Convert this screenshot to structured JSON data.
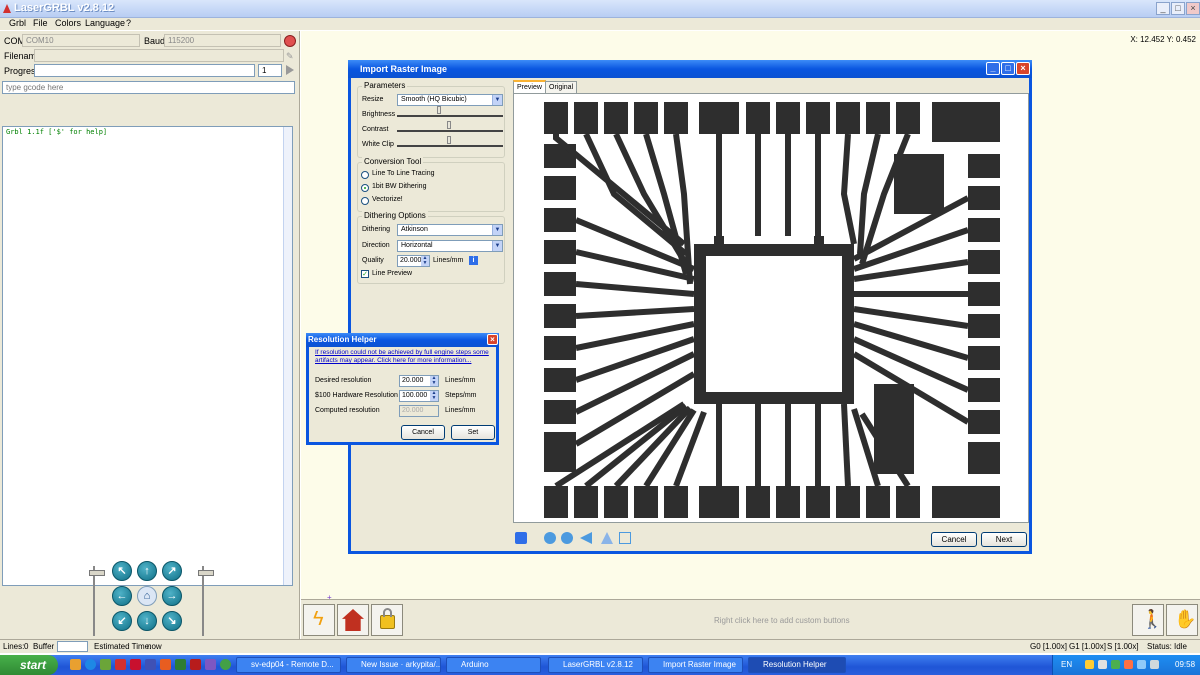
{
  "window": {
    "title": "LaserGRBL v2.8.12"
  },
  "menu": [
    "Grbl",
    "File",
    "Colors",
    "Language",
    "?"
  ],
  "connection": {
    "com_label": "COM",
    "com_value": "COM10",
    "baud_label": "Baud",
    "baud_value": "115200",
    "filename_label": "Filename",
    "filename_value": "",
    "progress_label": "Progress",
    "progress_count": "1",
    "gcode_placeholder": "type gcode here"
  },
  "console": {
    "line": "Grbl 1.1f ['$' for help]"
  },
  "jog_icons": [
    "arrow-up-left",
    "arrow-up",
    "arrow-up-right",
    "arrow-left",
    "home",
    "arrow-right",
    "arrow-down-left",
    "arrow-down",
    "arrow-down-right"
  ],
  "workspace": {
    "coords": "X: 12.452 Y: 0.452",
    "custom_hint": "Right click here to add custom buttons"
  },
  "status_bar": {
    "lines_label": "Lines:",
    "lines_value": "0",
    "buffer_label": "Buffer",
    "time_label": "Estimated Time:",
    "time_value": "now",
    "g0": "G0 [1.00x]",
    "g1": "G1 [1.00x]",
    "s": "S [1.00x]",
    "status_label": "Status:",
    "status_value": "Idle"
  },
  "taskbar": {
    "start": "start",
    "tasks": [
      "sv-edp04 - Remote D...",
      "New Issue · arkypita/...",
      "Arduino",
      "LaserGRBL v2.8.12",
      "Import Raster Image",
      "Resolution Helper"
    ],
    "lang": "EN",
    "clock": "09:58"
  },
  "import_dialog": {
    "title": "Import Raster Image",
    "parameters": "Parameters",
    "resize_label": "Resize",
    "resize_value": "Smooth (HQ Bicubic)",
    "brightness_label": "Brightness",
    "brightness_level": 0.4,
    "contrast_label": "Contrast",
    "contrast_level": 0.5,
    "whiteclip_label": "White Clip",
    "whiteclip_level": 0.5,
    "conversion_tool": "Conversion Tool",
    "tool_options": [
      "Line To Line Tracing",
      "1bit BW Dithering",
      "Vectorize!"
    ],
    "tool_selected": 1,
    "dithering_options": "Dithering Options",
    "dithering_label": "Dithering",
    "dithering_value": "Atkinson",
    "direction_label": "Direction",
    "direction_value": "Horizontal",
    "quality_label": "Quality",
    "quality_value": "20.000",
    "quality_unit": "Lines/mm",
    "line_preview": "Line Preview",
    "line_preview_checked": true,
    "tab_preview": "Preview",
    "tab_original": "Original",
    "cancel": "Cancel",
    "next": "Next"
  },
  "resolution_helper": {
    "title": "Resolution Helper",
    "link": "If resolution could not be achieved by full engine steps some artifacts may appear. Click here for more information...",
    "desired_label": "Desired resolution",
    "desired_value": "20.000",
    "desired_unit": "Lines/mm",
    "hw_label": "$100 Hardware Resolution",
    "hw_value": "100.000",
    "hw_unit": "Steps/mm",
    "computed_label": "Computed resolution",
    "computed_value": "20.000",
    "computed_unit": "Lines/mm",
    "cancel": "Cancel",
    "set": "Set"
  },
  "colors": {
    "accent": "#0a56e0",
    "preview_fill": "#2e2e2e",
    "console_text": "#008000"
  }
}
